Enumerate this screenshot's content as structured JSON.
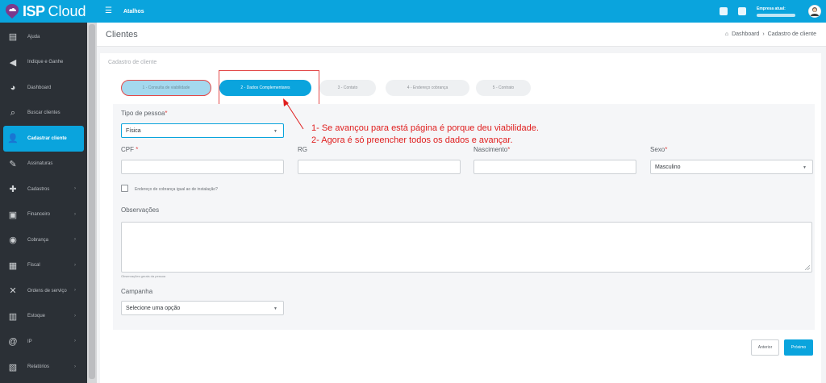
{
  "topbar": {
    "logo_bold": "ISP",
    "logo_light": "Cloud",
    "shortcut_label": "Atalhos",
    "empresa_label": "Empresa atual:",
    "accent": "#0aa4dd"
  },
  "sidebar": {
    "items": [
      {
        "label": "Ajuda",
        "icon": "book-icon"
      },
      {
        "label": "Indique e Ganhe",
        "icon": "megaphone-icon"
      },
      {
        "label": "Dashboard",
        "icon": "dashboard-icon"
      },
      {
        "label": "Buscar clientes",
        "icon": "search-icon"
      },
      {
        "label": "Cadastrar cliente",
        "icon": "add-user-icon",
        "active": true
      },
      {
        "label": "Assinaturas",
        "icon": "pencil-icon"
      },
      {
        "label": "Cadastros",
        "icon": "plus-icon",
        "has_children": true
      },
      {
        "label": "Financeiro",
        "icon": "money-icon",
        "has_children": true
      },
      {
        "label": "Cobrança",
        "icon": "eye-icon",
        "has_children": true
      },
      {
        "label": "Fiscal",
        "icon": "file-icon",
        "has_children": true
      },
      {
        "label": "Ordens de serviço",
        "icon": "wrench-icon",
        "has_children": true
      },
      {
        "label": "Estoque",
        "icon": "box-icon",
        "has_children": true
      },
      {
        "label": "IP",
        "icon": "at-icon",
        "has_children": true
      },
      {
        "label": "Relatórios",
        "icon": "report-icon",
        "has_children": true
      }
    ]
  },
  "header": {
    "title": "Clientes",
    "breadcrumb_home": "Dashboard",
    "breadcrumb_sep": "›",
    "breadcrumb_current": "Cadastro de cliente"
  },
  "card": {
    "title": "Cadastro de cliente"
  },
  "steps": [
    {
      "label": "1 - Consulta de viabilidade",
      "state": "done"
    },
    {
      "label": "2 - Dados Complementares",
      "state": "current"
    },
    {
      "label": "3 - Contato",
      "state": "pending"
    },
    {
      "label": "4 - Endereço cobrança",
      "state": "pending"
    },
    {
      "label": "5 - Contrato",
      "state": "pending"
    }
  ],
  "form": {
    "tipo_pessoa_label": "Tipo de pessoa",
    "tipo_pessoa_value": "Física",
    "cpf_label": "CPF",
    "rg_label": "RG",
    "nascimento_label": "Nascimento",
    "sexo_label": "Sexo",
    "sexo_value": "Masculino",
    "required_mark": "*",
    "billing_checkbox_label": "Endereço de cobrança igual ao de instalação?",
    "observacoes_label": "Observações",
    "observacoes_help": "Observações gerais da pessoa",
    "campanha_label": "Campanha",
    "campanha_value": "Selecione uma opção"
  },
  "annotation": {
    "line1": "1- Se avançou para está página é porque deu viabilidade.",
    "line2": "2- Agora é só preencher todos os dados e avançar.",
    "color": "#e01e1e"
  },
  "buttons": {
    "prev": "Anterior",
    "next": "Próximo"
  }
}
